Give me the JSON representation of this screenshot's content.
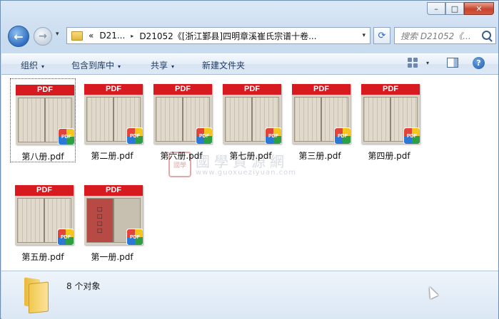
{
  "window": {
    "controls": [
      "–",
      "□",
      "✕"
    ]
  },
  "nav": {
    "back_icon": "←",
    "forward_icon": "→",
    "dropdown_icon": "▾"
  },
  "address": {
    "prefix": "«",
    "crumb1": "D21...",
    "sep": "▸",
    "crumb2": "D21052《[浙江鄞县]四明章溪崔氏宗谱十卷...",
    "dropdown_icon": "▾",
    "refresh_icon": "⟳"
  },
  "search": {
    "placeholder": "搜索 D21052《..."
  },
  "toolbar": {
    "organize": "组织",
    "include_library": "包含到库中",
    "share": "共享",
    "new_folder": "新建文件夹",
    "arrow": "▾",
    "help": "?"
  },
  "files": [
    {
      "name": "第八册.pdf",
      "banner": "PDF",
      "badge": "PDF",
      "selected": true
    },
    {
      "name": "第二册.pdf",
      "banner": "PDF",
      "badge": "PDF"
    },
    {
      "name": "第六册.pdf",
      "banner": "PDF",
      "badge": "PDF"
    },
    {
      "name": "第七册.pdf",
      "banner": "PDF",
      "badge": "PDF"
    },
    {
      "name": "第三册.pdf",
      "banner": "PDF",
      "badge": "PDF"
    },
    {
      "name": "第四册.pdf",
      "banner": "PDF",
      "badge": "PDF"
    },
    {
      "name": "第五册.pdf",
      "banner": "PDF",
      "badge": "PDF"
    },
    {
      "name": "第一册.pdf",
      "banner": "PDF",
      "badge": "PDF"
    }
  ],
  "watermark": {
    "seal": "國學",
    "title": "國學資源網",
    "url": "www.guoxueziyuan.com"
  },
  "status": {
    "count": "8 个对象"
  }
}
